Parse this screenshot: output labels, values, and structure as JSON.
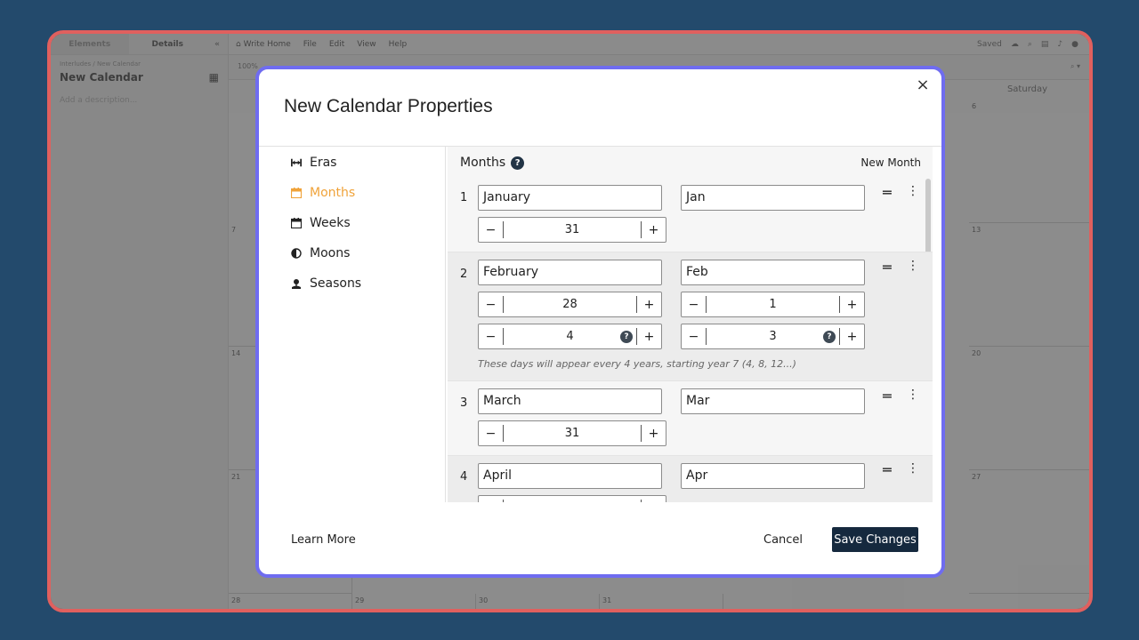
{
  "app": {
    "left_panel": {
      "tabs": [
        "Elements",
        "Details"
      ],
      "breadcrumb": "Interludes / New Calendar",
      "title": "New Calendar",
      "description_placeholder": "Add a description..."
    },
    "topbar": {
      "home": "Write Home",
      "menus": [
        "File",
        "Edit",
        "View",
        "Help"
      ],
      "saved": "Saved"
    },
    "toolbar": {
      "zoom": "100%"
    },
    "calendar": {
      "header": "Saturday",
      "day_numbers": [
        "6",
        "7",
        "13",
        "14",
        "20",
        "21",
        "27",
        "28",
        "29",
        "30",
        "31"
      ]
    }
  },
  "modal": {
    "title": "New Calendar Properties",
    "close_label": "×",
    "nav": [
      {
        "label": "Eras",
        "icon": "eras-icon",
        "active": false
      },
      {
        "label": "Months",
        "icon": "calendar-icon",
        "active": true
      },
      {
        "label": "Weeks",
        "icon": "week-icon",
        "active": false
      },
      {
        "label": "Moons",
        "icon": "moon-icon",
        "active": false
      },
      {
        "label": "Seasons",
        "icon": "seasons-icon",
        "active": false
      }
    ],
    "section_title": "Months",
    "help_label": "?",
    "new_month_label": "New Month",
    "months": [
      {
        "num": "1",
        "name": "January",
        "abbr": "Jan",
        "days": "31"
      },
      {
        "num": "2",
        "name": "February",
        "abbr": "Feb",
        "days": "28",
        "leap_days": "1",
        "leap_interval": "4",
        "leap_offset": "3",
        "leap_note": "These days will appear every 4 years, starting year 7 (4, 8, 12...)"
      },
      {
        "num": "3",
        "name": "March",
        "abbr": "Mar",
        "days": "31"
      },
      {
        "num": "4",
        "name": "April",
        "abbr": "Apr"
      }
    ],
    "stepper_minus": "−",
    "stepper_plus": "+",
    "footer": {
      "learn_more": "Learn More",
      "cancel": "Cancel",
      "save": "Save Changes"
    },
    "colors": {
      "accent": "#f0a33a",
      "primary": "#15293e",
      "modal_border": "#6f6cf0",
      "frame_border": "#e0605e"
    }
  }
}
